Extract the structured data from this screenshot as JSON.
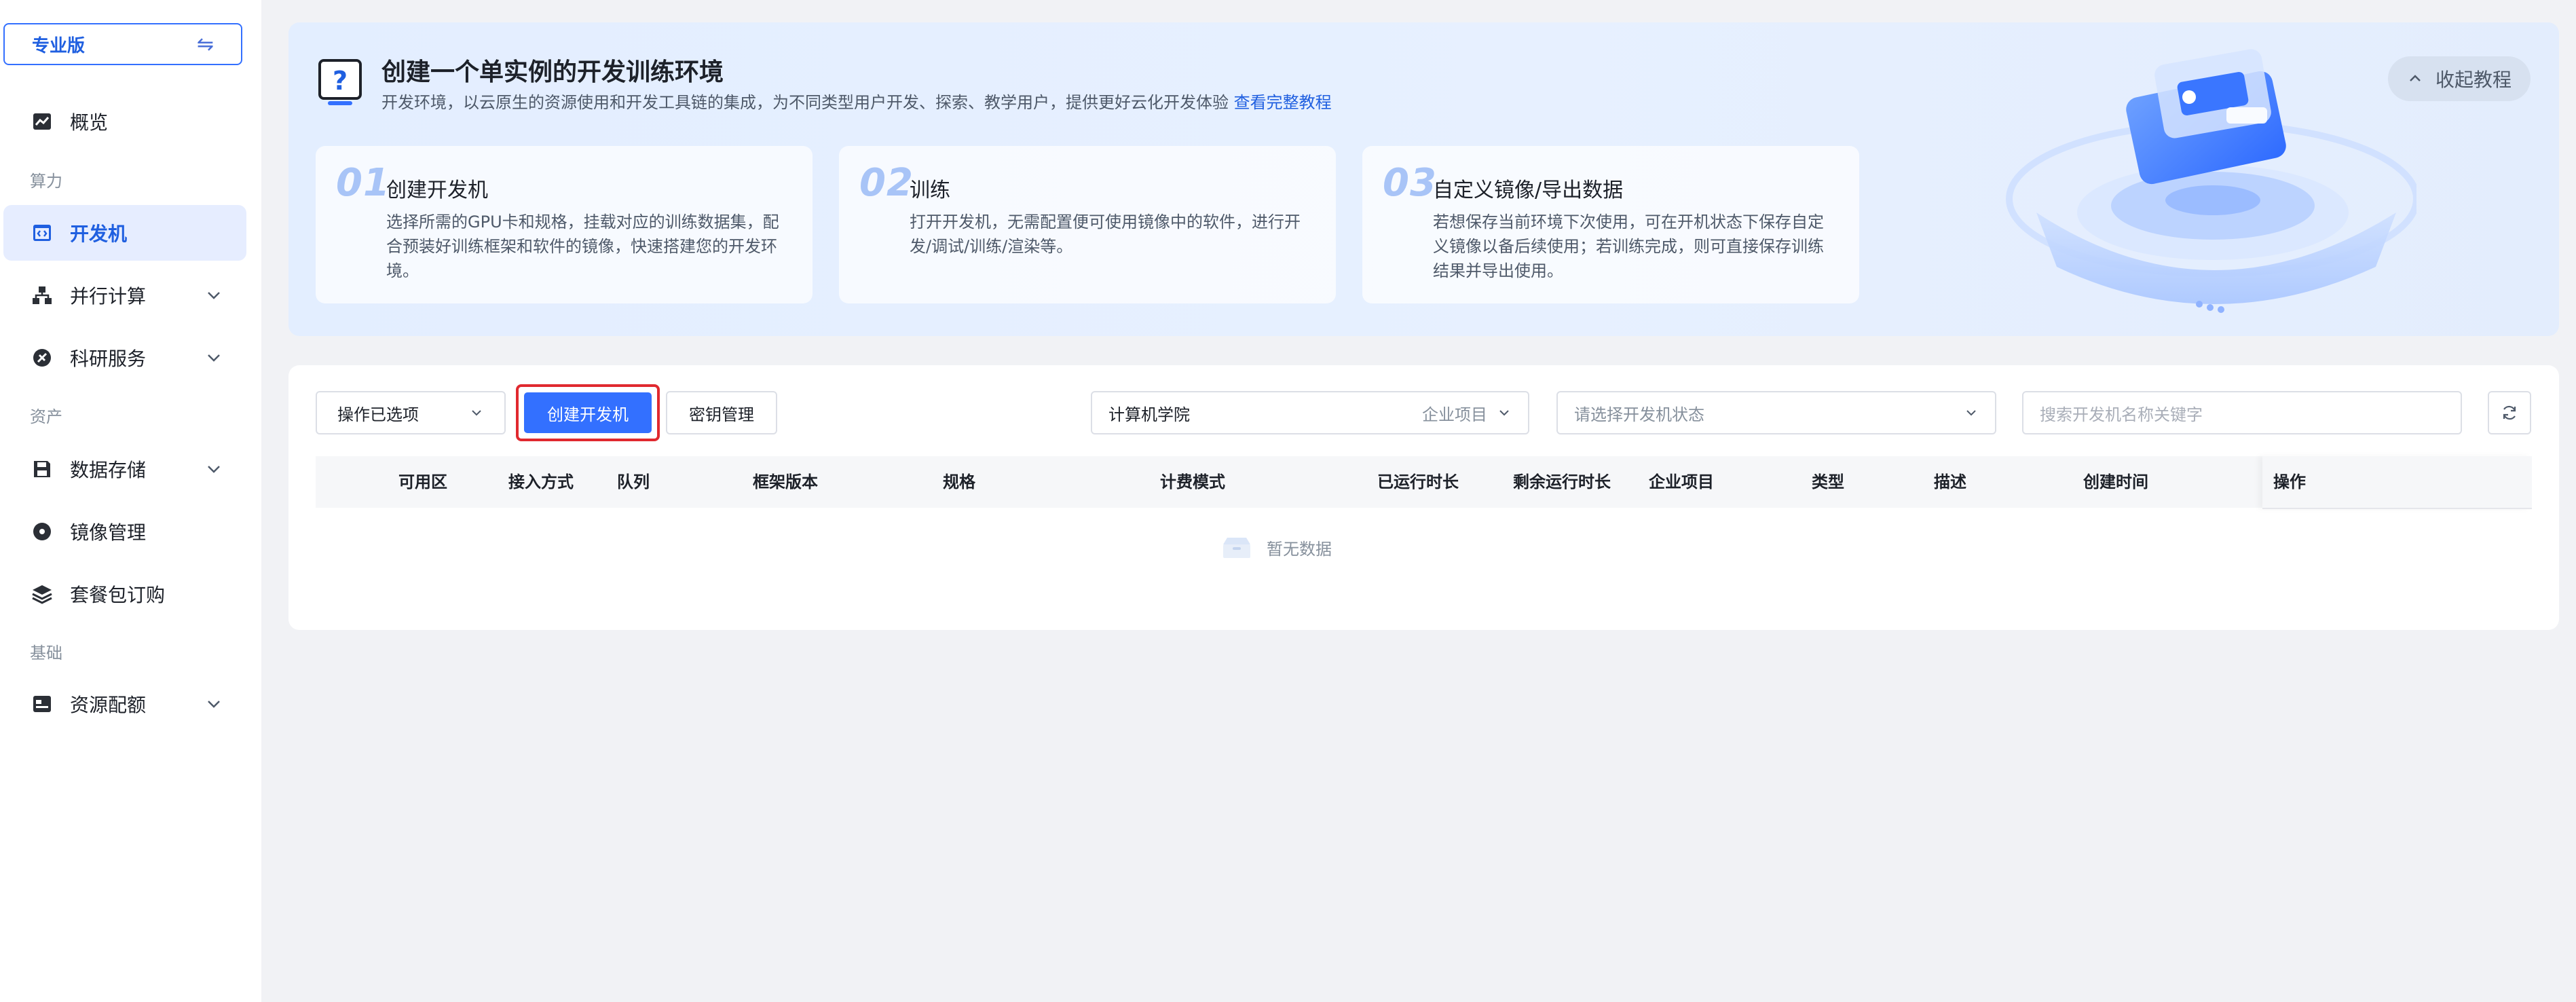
{
  "sidebar": {
    "edition_label": "专业版",
    "edition_icon": "swap-arrows-icon",
    "items": [
      {
        "label": "概览",
        "icon": "chart-line-icon"
      },
      {
        "label": "开发机",
        "icon": "code-window-icon",
        "active": true
      },
      {
        "label": "并行计算",
        "icon": "hierarchy-icon",
        "expandable": true
      },
      {
        "label": "科研服务",
        "icon": "flask-icon",
        "expandable": true
      },
      {
        "label": "数据存储",
        "icon": "floppy-disk-icon",
        "expandable": true
      },
      {
        "label": "镜像管理",
        "icon": "disc-icon"
      },
      {
        "label": "套餐包订购",
        "icon": "layers-icon"
      },
      {
        "label": "资源配额",
        "icon": "quota-icon",
        "expandable": true
      }
    ],
    "groups": {
      "compute": "算力",
      "assets": "资产",
      "basic": "基础"
    },
    "accent_color": "#3370ff"
  },
  "banner": {
    "title": "创建一个单实例的开发训练环境",
    "subtitle": "开发环境，以云原生的资源使用和开发工具链的集成，为不同类型用户开发、探索、教学用户，提供更好云化开发体验",
    "link_text": "查看完整教程",
    "collapse_label": "收起教程",
    "steps": [
      {
        "num": "01",
        "title": "创建开发机",
        "desc": "选择所需的GPU卡和规格，挂载对应的训练数据集，配合预装好训练框架和软件的镜像，快速搭建您的开发环境。"
      },
      {
        "num": "02",
        "title": "训练",
        "desc": "打开开发机，无需配置便可使用镜像中的软件，进行开发/调试/训练/渲染等。"
      },
      {
        "num": "03",
        "title": "自定义镜像/导出数据",
        "desc": "若想保存当前环境下次使用，可在开机状态下保存自定义镜像以备后续使用；若训练完成，则可直接保存训练结果并导出使用。"
      }
    ]
  },
  "toolbar": {
    "ops_label": "操作已选项",
    "create_label": "创建开发机",
    "key_label": "密钥管理",
    "company_value": "计算机学院",
    "company_type": "企业项目",
    "status_placeholder": "请选择开发机状态",
    "search_placeholder": "搜索开发机名称关键字"
  },
  "table": {
    "columns": [
      "可用区",
      "接入方式",
      "队列",
      "框架版本",
      "规格",
      "计费模式",
      "已运行时长",
      "剩余运行时长",
      "企业项目",
      "类型",
      "描述",
      "创建时间",
      "操作"
    ],
    "empty_text": "暂无数据"
  }
}
